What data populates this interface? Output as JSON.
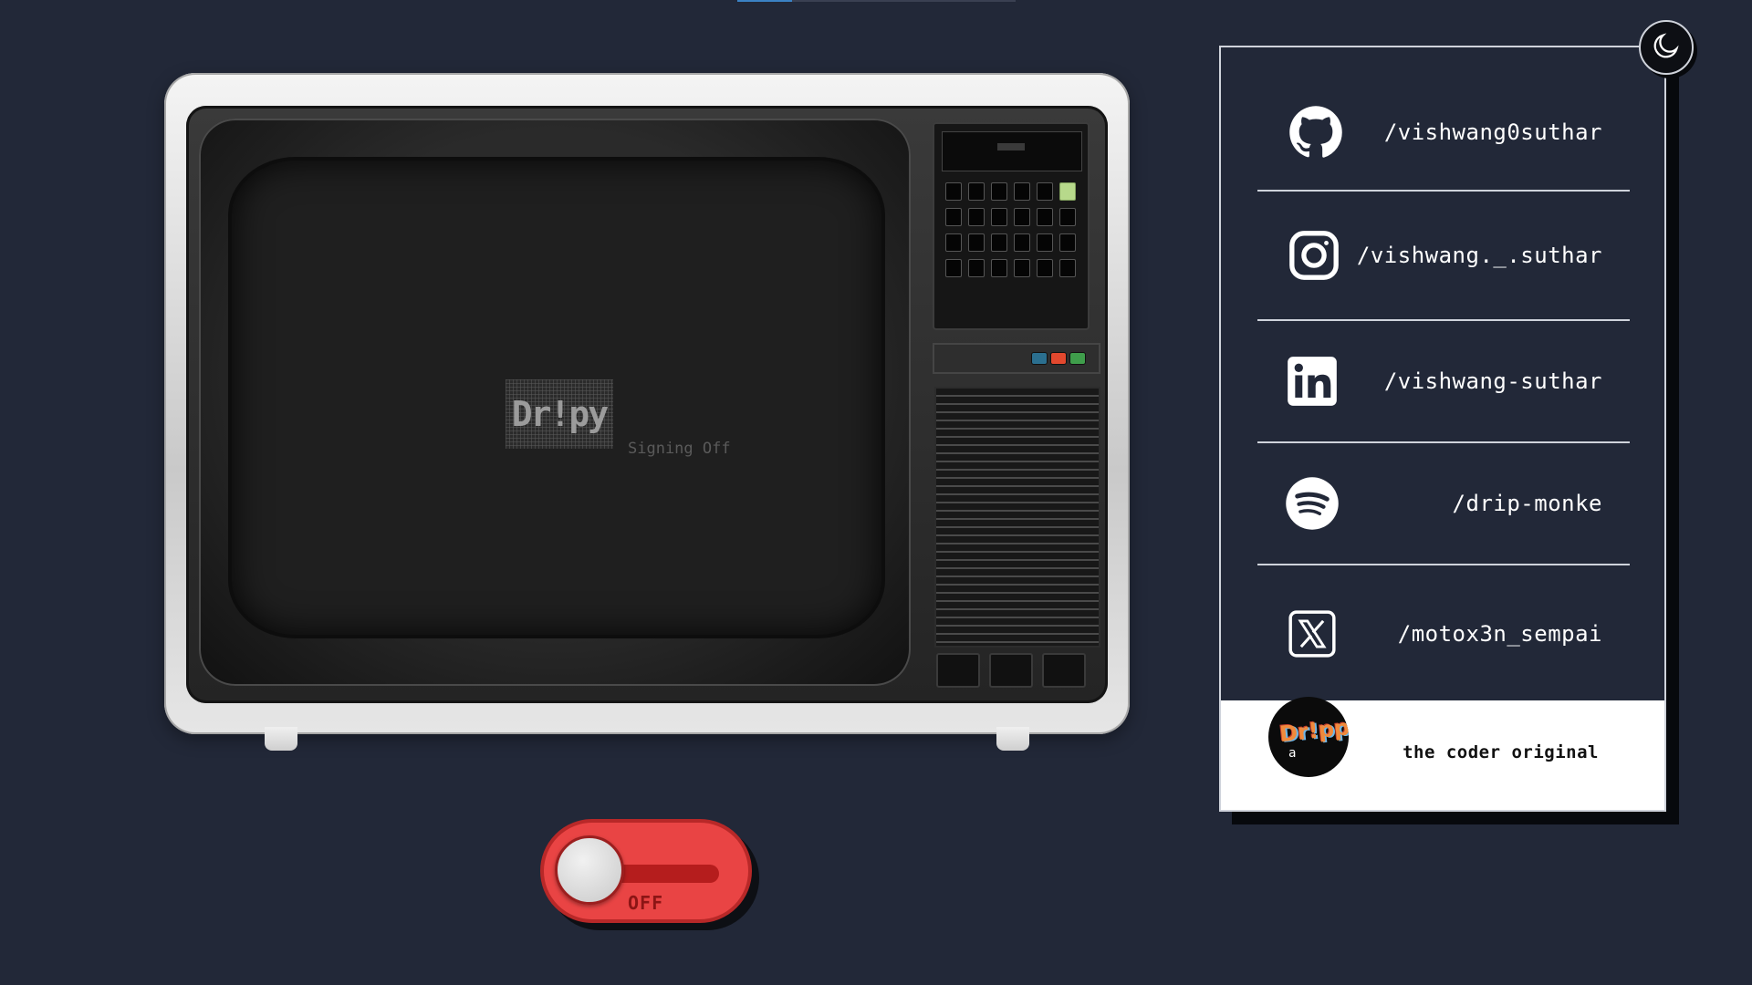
{
  "tv": {
    "logo_text": "Dr!py",
    "status_text": "Signing Off"
  },
  "power_toggle": {
    "state_label": "OFF"
  },
  "theme_toggle": {
    "icon": "moon-icon"
  },
  "social": {
    "links": [
      {
        "icon": "github-icon",
        "handle": "/vishwang0suthar"
      },
      {
        "icon": "instagram-icon",
        "handle": "/vishwang._.suthar"
      },
      {
        "icon": "linkedin-icon",
        "handle": "/vishwang-suthar"
      },
      {
        "icon": "spotify-icon",
        "handle": "/drip-monke"
      },
      {
        "icon": "x-icon",
        "handle": "/motox3n_sempai"
      }
    ],
    "footer": {
      "avatar_icon": "avatar-icon",
      "avatar_text": "Dr!pply",
      "avatar_small": "a",
      "tagline": "the coder original"
    }
  },
  "colors": {
    "background": "#222838",
    "toggle_red": "#e94444",
    "card_border": "#cfd3db",
    "footer_bg": "#ffffff"
  }
}
